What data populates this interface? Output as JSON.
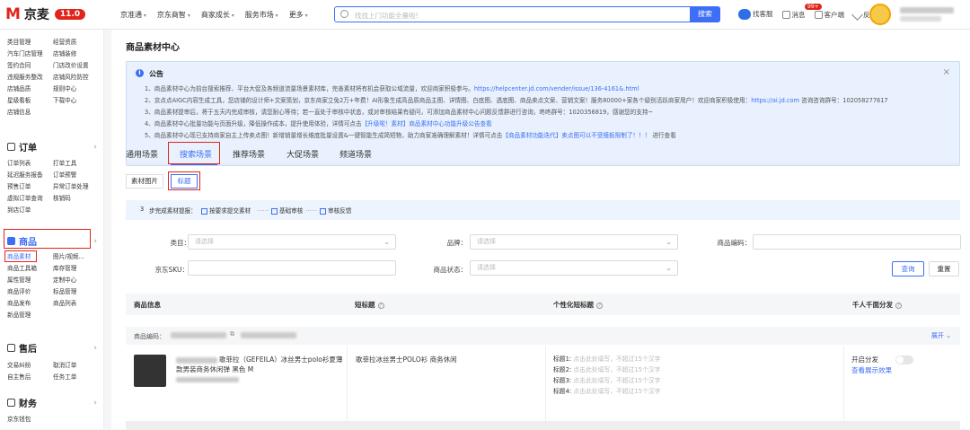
{
  "topbar": {
    "logo_text": "京麦",
    "logo_version": "11.0",
    "nav": [
      "京准通",
      "京东商智",
      "商家成长",
      "服务市场",
      "更多"
    ],
    "search_placeholder": "找找上门功能全量啦!",
    "search_button": "搜索",
    "tools": [
      "找客服",
      "消息",
      "客户端",
      "反馈"
    ],
    "message_badge": "99+"
  },
  "sidebar": {
    "top_grid": [
      "类目管理",
      "经营资质",
      "汽车门店管理",
      "店铺装修",
      "签约合同",
      "门店改价设置",
      "违规服务整改",
      "店铺风险防控",
      "店铺品质",
      "规则中心",
      "星级看板",
      "下载中心",
      "店铺信息",
      ""
    ],
    "orders": {
      "title": "订单",
      "items": [
        "订单列表",
        "打单工具",
        "延迟服务报备",
        "订单预警",
        "预售订单",
        "异常订单处理",
        "虚拟订单查询",
        "核销码",
        "到店订单",
        ""
      ]
    },
    "goods": {
      "title": "商品",
      "items": [
        "商品素材",
        "图片/视频...",
        "商品工具箱",
        "库存管理",
        "属性管理",
        "定制中心",
        "商品评价",
        "标品管理",
        "商品发布",
        "商品列表",
        "新品管理",
        ""
      ]
    },
    "aftersale": {
      "title": "售后",
      "items": [
        "交易纠纷",
        "取消订单",
        "自主售后",
        "任务工单"
      ]
    },
    "finance": {
      "title": "财务",
      "items": [
        "京东钱包"
      ]
    }
  },
  "main": {
    "title": "商品素材中心",
    "notice": {
      "title": "公告",
      "lines": [
        {
          "text": "1、商品素材中心为前台搜索推荐、平台大促及各频道流量场景素材库，完善素材将有机会获取公域流量，欢迎商家积极参与。",
          "link": "https://helpcenter.jd.com/vender/issue/136-4161&.html",
          "tail": ""
        },
        {
          "text": "2、京点点AIGC内容生成工具，您店铺的设计师+文案策划，京东商家立免2万+年费！AI形象生成高品质商品主图、详情图、白底图、透底图、商品卖点文案、营销文案！服务80000+家各个级别活跃商家用户！欢迎商家积极使用：",
          "link": "https://ai.jd.com",
          "tail": " 咨询咨询群号：102058277617"
        },
        {
          "text": "3、商品素材提审后，将于五天内完成审核，请您耐心等待；若一直处于审核中状态，或对审核结果有疑问，可添加商品素材中心问题反馈群进行咨询，咚咚群号：1020356819，感谢您的支持~",
          "link": "",
          "tail": ""
        },
        {
          "text": "4、商品素材中心批量功能与页面升级，降低操作成本，提升使用体验，详情可点击",
          "link": "【升级啦！素材】商品素材中心功能升级公告查看",
          "tail": ""
        },
        {
          "text": "5、商品素材中心现已支持商家自主上传卖点图！新增销量增长维度批量设置&一键智能生成简短物，助力商家准确理解素材！详情可点击",
          "link": "【商品素材功能迭代】卖点图可以不受模板限制了！！！",
          "tail": " 进行查看"
        }
      ]
    },
    "tabs": [
      "通用场景",
      "搜索场景",
      "推荐场景",
      "大促场景",
      "频道场景"
    ],
    "subtabs": [
      "素材图片",
      "标题"
    ],
    "steps": {
      "number": "3",
      "prefix": "步完成素材提报：",
      "items": [
        "按要求提交素材",
        "基础审核",
        "审核反馈"
      ],
      "sep": "……"
    },
    "filters": {
      "category_label": "类目：",
      "brand_label": "品牌：",
      "code_label": "商品编码：",
      "sku_label": "京东SKU：",
      "status_label": "商品状态：",
      "placeholder": "请选择",
      "query": "查询",
      "reset": "重置"
    },
    "table": {
      "headers": [
        "商品信息",
        "短标题",
        "个性化短标题",
        "千人千面分发"
      ],
      "code_label": "商品编码：",
      "expand": "展开",
      "product_title": "歌菲拉（GEFEILA）冰丝男士polo衫夏薄款男装商务休闲弹 黑色 M",
      "short_title": "歌菲拉冰丝男士POLO衫 商务休闲",
      "title_slots": [
        "标题1:",
        "标题2:",
        "标题3:",
        "标题4:"
      ],
      "slot_hint": "点击此处填写，不超过15个汉字",
      "distribute": "开启分发",
      "view_effect": "查看展示效果"
    }
  },
  "colors": {
    "accent": "#3e6ef5",
    "brand": "#e1251b",
    "highlight": "#e1251b"
  }
}
